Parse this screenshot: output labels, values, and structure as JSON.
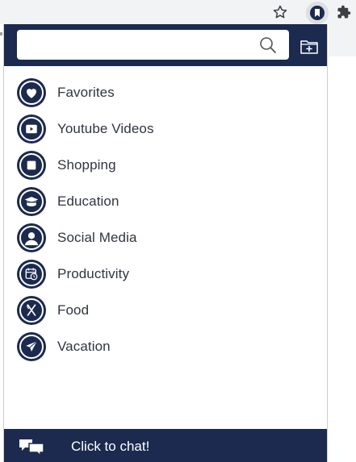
{
  "colors": {
    "brand_navy": "#1b2a4e",
    "toolbar_gray": "#f1f3f4",
    "label_text": "#2f3542"
  },
  "browser_toolbar": {
    "icons": [
      "star-icon",
      "bookmark-extension-icon",
      "puzzle-icon"
    ]
  },
  "search": {
    "value": "",
    "placeholder": ""
  },
  "categories": [
    {
      "label": "Favorites",
      "icon": "heart-icon"
    },
    {
      "label": "Youtube Videos",
      "icon": "play-icon"
    },
    {
      "label": "Shopping",
      "icon": "square-icon"
    },
    {
      "label": "Education",
      "icon": "graduation-cap-icon"
    },
    {
      "label": "Social Media",
      "icon": "person-icon"
    },
    {
      "label": "Productivity",
      "icon": "calendar-clock-icon"
    },
    {
      "label": "Food",
      "icon": "utensils-icon"
    },
    {
      "label": "Vacation",
      "icon": "airplane-icon"
    }
  ],
  "chat": {
    "label": "Click to chat!",
    "icon": "chat-bubbles-icon"
  }
}
